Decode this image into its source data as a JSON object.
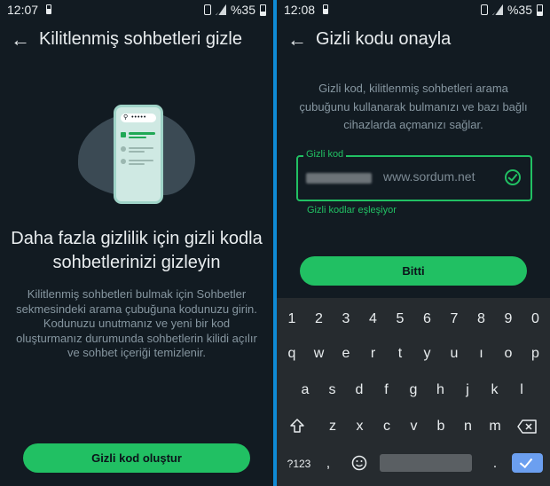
{
  "left": {
    "status": {
      "time": "12:07",
      "battery": "%35"
    },
    "title": "Kilitlenmiş sohbetleri gizle",
    "illustration_search": "•••••",
    "headline": "Daha fazla gizlilik için gizli kodla sohbetlerinizi gizleyin",
    "description": "Kilitlenmiş sohbetleri bulmak için Sohbetler sekmesindeki arama çubuğuna kodunuzu girin. Kodunuzu unutmanız ve yeni bir kod oluşturmanız durumunda sohbetlerin kilidi açılır ve sohbet içeriği temizlenir.",
    "button": "Gizli kod oluştur"
  },
  "right": {
    "status": {
      "time": "12:08",
      "battery": "%35"
    },
    "title": "Gizli kodu onayla",
    "description": "Gizli kod, kilitlenmiş sohbetleri arama çubuğunu kullanarak bulmanızı ve bazı bağlı cihazlarda açmanızı sağlar.",
    "field_label": "Gizli kod",
    "watermark": "www.sordum.net",
    "match_text": "Gizli kodlar eşleşiyor",
    "button": "Bitti"
  },
  "keyboard": {
    "numbers": [
      "1",
      "2",
      "3",
      "4",
      "5",
      "6",
      "7",
      "8",
      "9",
      "0"
    ],
    "row1": [
      "q",
      "w",
      "e",
      "r",
      "t",
      "y",
      "u",
      "ı",
      "o",
      "p"
    ],
    "row2": [
      "a",
      "s",
      "d",
      "f",
      "g",
      "h",
      "j",
      "k",
      "l"
    ],
    "row3": [
      "z",
      "x",
      "c",
      "v",
      "b",
      "n",
      "m"
    ],
    "symbols_key": "?123",
    "comma": ",",
    "period": "."
  }
}
